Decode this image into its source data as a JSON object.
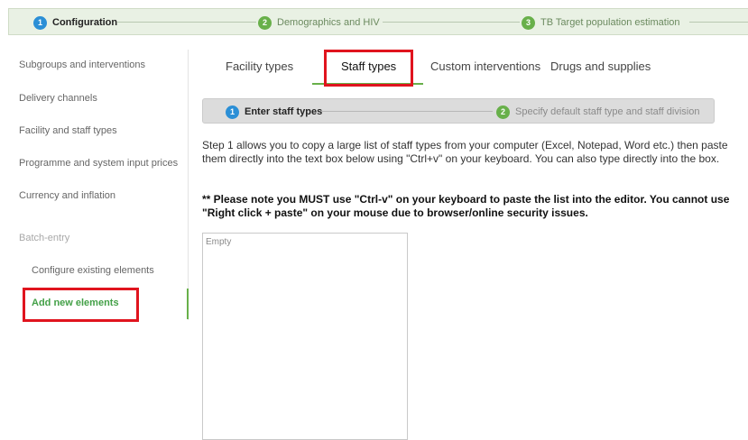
{
  "wizard": {
    "steps": [
      {
        "number": "1",
        "label": "Configuration"
      },
      {
        "number": "2",
        "label": "Demographics and HIV"
      },
      {
        "number": "3",
        "label": "TB Target population estimation"
      }
    ]
  },
  "sidebar": {
    "items": [
      {
        "label": "Subgroups and interventions"
      },
      {
        "label": "Delivery channels"
      },
      {
        "label": "Facility and staff types"
      },
      {
        "label": "Programme and system input prices"
      },
      {
        "label": "Currency and inflation"
      },
      {
        "label": "Batch-entry"
      },
      {
        "label": "Configure existing elements"
      },
      {
        "label": "Add new elements"
      }
    ]
  },
  "tabs": [
    {
      "label": "Facility types"
    },
    {
      "label": "Staff types"
    },
    {
      "label": "Custom interventions"
    },
    {
      "label": "Drugs and supplies"
    }
  ],
  "substeps": [
    {
      "number": "1",
      "label": "Enter staff types"
    },
    {
      "number": "2",
      "label": "Specify default staff type and staff division"
    }
  ],
  "content": {
    "description": "Step 1 allows you to copy a large list of staff types from your computer (Excel, Notepad, Word etc.) then paste them directly into the text box below using \"Ctrl+v\" on your keyboard. You can also type directly into the box.",
    "warning": "** Please note you MUST use \"Ctrl-v\" on your keyboard to paste the list into the editor. You cannot use \"Right click + paste\" on your mouse due to browser/online security issues."
  },
  "editor": {
    "placeholder": "Empty"
  },
  "colors": {
    "accent_green": "#68b04a",
    "step_blue": "#2b8fd6",
    "highlight_red": "#e0141e"
  }
}
